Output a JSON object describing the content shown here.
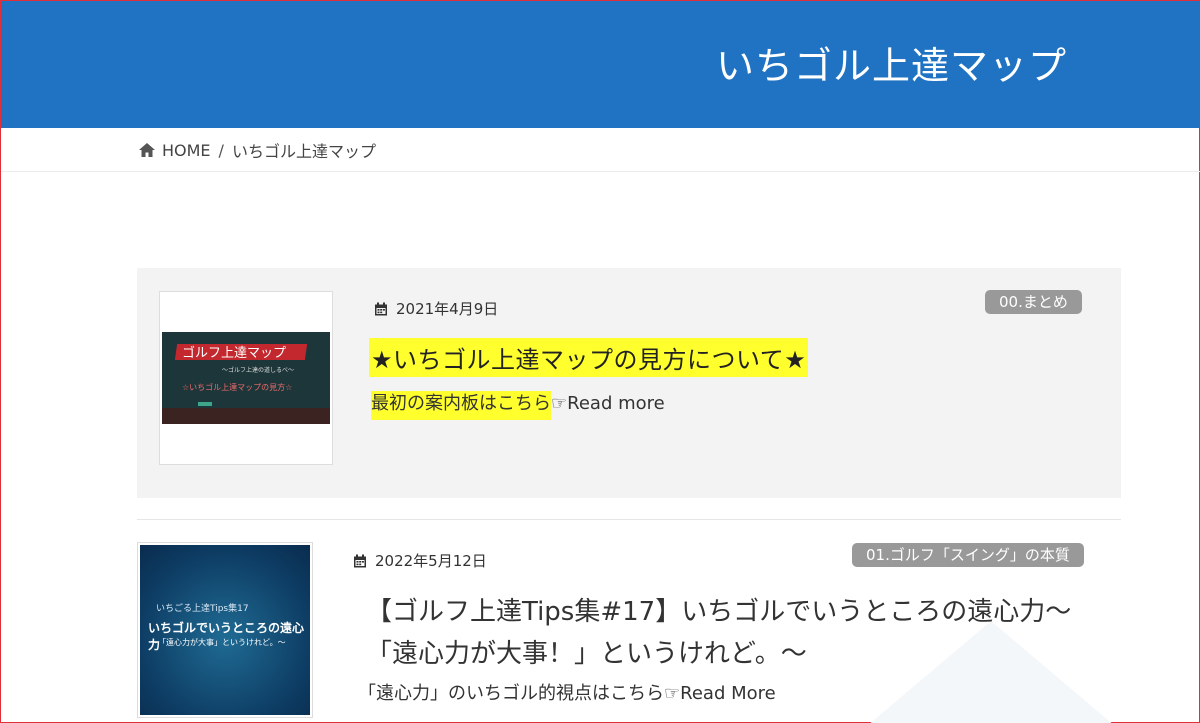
{
  "header": {
    "site_title": "いちゴル上達マップ"
  },
  "breadcrumb": {
    "home_label": "HOME",
    "separator": "/",
    "current": "いちゴル上達マップ"
  },
  "posts": [
    {
      "date": "2021年4月9日",
      "category": "00.まとめ",
      "title": "★いちゴル上達マップの見方について★",
      "excerpt_highlight": "最初の案内板はこちら",
      "excerpt_rest": "☞Read more",
      "thumbnail": {
        "title": "ゴルフ上達マップ",
        "subtitle": "〜ゴルフ上達の道しるべ〜",
        "line": "☆いちゴル上達マップの見方☆"
      }
    },
    {
      "date": "2022年5月12日",
      "category": "01.ゴルフ「スイング」の本質",
      "title_line1": "【ゴルフ上達Tips集#17】いちゴルでいうところの遠心力〜",
      "title_line2": "「遠心力が大事！」というけれど。〜",
      "excerpt": "「遠心力」のいちゴル的視点はこちら☞Read More",
      "thumbnail": {
        "line1": "いちごる上達Tips集17",
        "line2": "いちゴルでいうところの遠心力",
        "line3": "〜「遠心力が大事」というけれど。〜"
      }
    }
  ],
  "colors": {
    "header_bg": "#2073c3",
    "highlight": "#ffff2e",
    "badge_bg": "#999999"
  }
}
